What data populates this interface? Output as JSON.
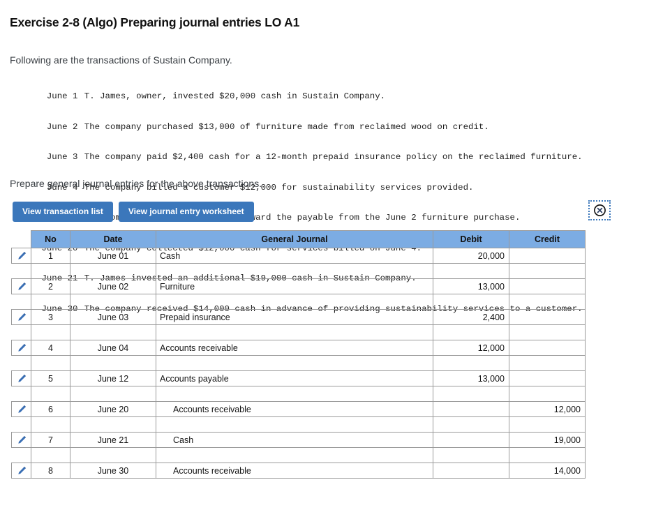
{
  "page_title": "Exercise 2-8 (Algo) Preparing journal entries LO A1",
  "intro": "Following are the transactions of Sustain Company.",
  "transactions": [
    {
      "date": "June 1",
      "description": "T. James, owner, invested $20,000 cash in Sustain Company."
    },
    {
      "date": "June 2",
      "description": "The company purchased $13,000 of furniture made from reclaimed wood on credit."
    },
    {
      "date": "June 3",
      "description": "The company paid $2,400 cash for a 12-month prepaid insurance policy on the reclaimed furniture."
    },
    {
      "date": "June 4",
      "description": "The company billed a customer $12,000 for sustainability services provided."
    },
    {
      "date": "June 12",
      "description": "The company paid $13,000 cash toward the payable from the June 2 furniture purchase."
    },
    {
      "date": "June 20",
      "description": "The company collected $12,000 cash for services billed on June 4."
    },
    {
      "date": "June 21",
      "description": "T. James invested an additional $19,000 cash in Sustain Company."
    },
    {
      "date": "June 30",
      "description": "The company received $14,000 cash in advance of providing sustainability services to a customer."
    }
  ],
  "prompt": "Prepare general journal entries for the above transactions.",
  "buttons": {
    "transaction_list": "View transaction list",
    "journal_worksheet": "View journal entry worksheet"
  },
  "close_icon": "circle-x-icon",
  "journal": {
    "headers": {
      "edit": "",
      "no": "No",
      "date": "Date",
      "general_journal": "General Journal",
      "debit": "Debit",
      "credit": "Credit"
    },
    "rows": [
      {
        "no": "1",
        "date": "June 01",
        "account": "Cash",
        "indent": false,
        "debit": "20,000",
        "credit": ""
      },
      {
        "no": "2",
        "date": "June 02",
        "account": "Furniture",
        "indent": false,
        "debit": "13,000",
        "credit": ""
      },
      {
        "no": "3",
        "date": "June 03",
        "account": "Prepaid insurance",
        "indent": false,
        "debit": "2,400",
        "credit": ""
      },
      {
        "no": "4",
        "date": "June 04",
        "account": "Accounts receivable",
        "indent": false,
        "debit": "12,000",
        "credit": ""
      },
      {
        "no": "5",
        "date": "June 12",
        "account": "Accounts payable",
        "indent": false,
        "debit": "13,000",
        "credit": ""
      },
      {
        "no": "6",
        "date": "June 20",
        "account": "Accounts receivable",
        "indent": true,
        "debit": "",
        "credit": "12,000"
      },
      {
        "no": "7",
        "date": "June 21",
        "account": "Cash",
        "indent": true,
        "debit": "",
        "credit": "19,000"
      },
      {
        "no": "8",
        "date": "June 30",
        "account": "Accounts receivable",
        "indent": true,
        "debit": "",
        "credit": "14,000"
      }
    ]
  },
  "colors": {
    "header_blue": "#7cace3",
    "button_blue": "#3b77bb",
    "border_gray": "#9a9a9a",
    "pencil_blue": "#3a6fb5"
  }
}
